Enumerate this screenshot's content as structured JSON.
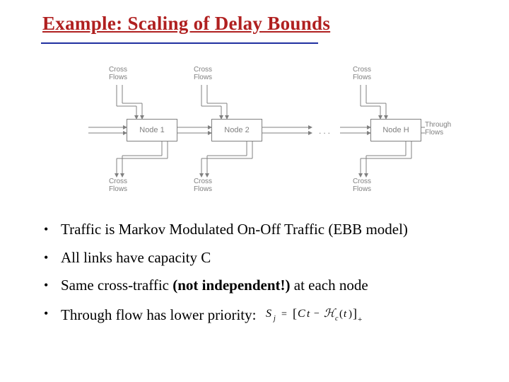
{
  "title": "Example: Scaling of Delay Bounds",
  "diagram": {
    "nodes": [
      "Node 1",
      "Node 2",
      "Node H"
    ],
    "cross_label": "Cross\nFlows",
    "through_label": "Through\nFlows",
    "dots": "..."
  },
  "bullets": [
    {
      "pre": "Traffic is Markov Modulated On-Off Traffic (EBB model)",
      "bold": "",
      "post": ""
    },
    {
      "pre": "All links have capacity C",
      "bold": "",
      "post": ""
    },
    {
      "pre": "Same cross-traffic ",
      "bold": "(not independent!)",
      "post": " at each node"
    },
    {
      "pre": "Through flow has lower priority: ",
      "bold": "",
      "post": "",
      "formula": true
    }
  ],
  "formula": {
    "lhs_sub": "j",
    "rhs_sub": "c"
  }
}
